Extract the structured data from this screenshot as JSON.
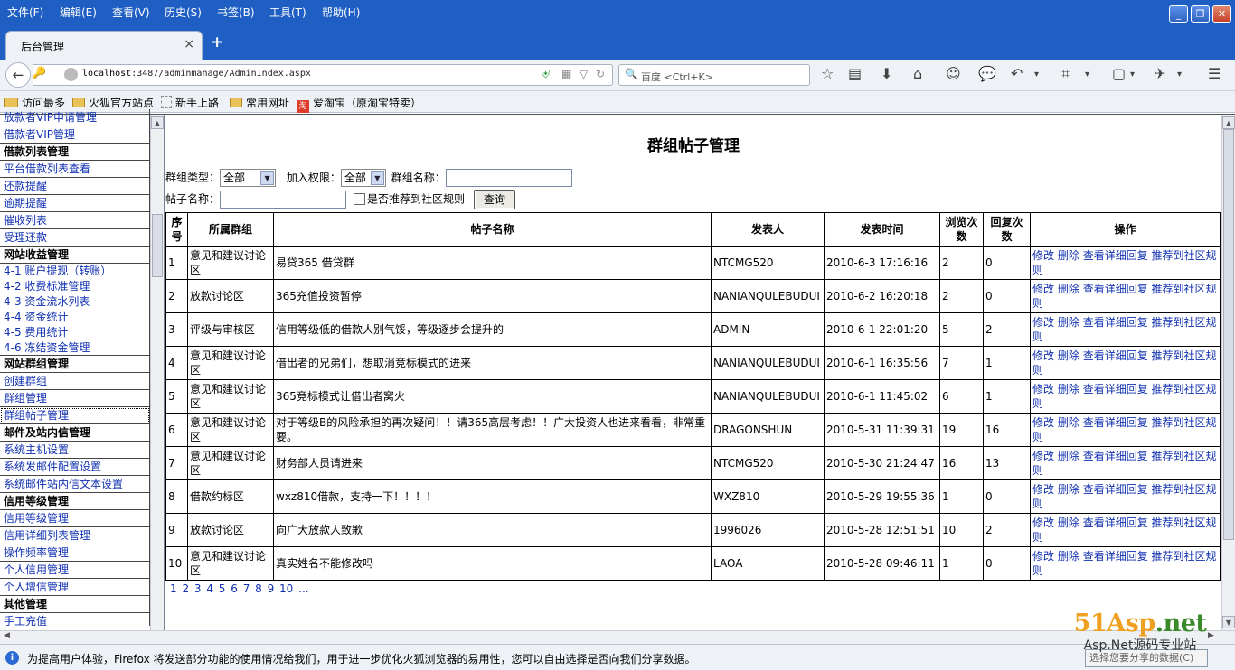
{
  "menu": [
    "文件(F)",
    "编辑(E)",
    "查看(V)",
    "历史(S)",
    "书签(B)",
    "工具(T)",
    "帮助(H)"
  ],
  "tab": {
    "title": "后台管理",
    "close": "×",
    "newtab": "+"
  },
  "url": {
    "host": "localhost",
    "rest": ":3487/adminmanage/AdminIndex.aspx"
  },
  "search": {
    "placeholder": "百度 <Ctrl+K>"
  },
  "bookmarks": [
    "访问最多",
    "火狐官方站点",
    "新手上路",
    "常用网址",
    "爱淘宝（原淘宝特卖）"
  ],
  "sidebar": [
    {
      "label": "放款者VIP申请管理",
      "type": "link"
    },
    {
      "label": "借款者VIP管理",
      "type": "link"
    },
    {
      "label": "借款列表管理",
      "type": "header"
    },
    {
      "label": "平台借款列表查看",
      "type": "link"
    },
    {
      "label": "还款提醒",
      "type": "link"
    },
    {
      "label": "逾期提醒",
      "type": "link"
    },
    {
      "label": "催收列表",
      "type": "link"
    },
    {
      "label": "受理还款",
      "type": "link"
    },
    {
      "label": "网站收益管理",
      "type": "header"
    },
    {
      "label": "4-1 账户提现（转账）",
      "type": "sub"
    },
    {
      "label": "4-2 收费标准管理",
      "type": "sub"
    },
    {
      "label": "4-3 资金流水列表",
      "type": "sub"
    },
    {
      "label": "4-4 资金统计",
      "type": "sub"
    },
    {
      "label": "4-5 费用统计",
      "type": "sub"
    },
    {
      "label": "4-6 冻结资金管理",
      "type": "sub-last"
    },
    {
      "label": "网站群组管理",
      "type": "header"
    },
    {
      "label": "创建群组",
      "type": "link"
    },
    {
      "label": "群组管理",
      "type": "link"
    },
    {
      "label": "群组帖子管理",
      "type": "active"
    },
    {
      "label": "邮件及站内信管理",
      "type": "header"
    },
    {
      "label": "系统主机设置",
      "type": "link"
    },
    {
      "label": "系统发邮件配置设置",
      "type": "link"
    },
    {
      "label": "系统邮件站内信文本设置",
      "type": "link"
    },
    {
      "label": "信用等级管理",
      "type": "header"
    },
    {
      "label": "信用等级管理",
      "type": "link"
    },
    {
      "label": "信用详细列表管理",
      "type": "link"
    },
    {
      "label": "操作频率管理",
      "type": "link"
    },
    {
      "label": "个人信用管理",
      "type": "link"
    },
    {
      "label": "个人增信管理",
      "type": "link"
    },
    {
      "label": "其他管理",
      "type": "header"
    },
    {
      "label": "手工充值",
      "type": "link"
    }
  ],
  "page": {
    "title": "群组帖子管理",
    "group_type_label": "群组类型：",
    "group_type_value": "全部",
    "join_perm_label": "加入权限：",
    "join_perm_value": "全部",
    "group_name_label": "群组名称：",
    "post_name_label": "帖子名称：",
    "recommend_label": "是否推荐到社区规则",
    "query_button": "查询"
  },
  "table": {
    "headers": [
      "序号",
      "所属群组",
      "帖子名称",
      "发表人",
      "发表时间",
      "浏览次数",
      "回复次数",
      "操作"
    ],
    "ops": [
      "修改",
      "删除",
      "查看详细回复",
      "推荐到社区规则"
    ],
    "rows": [
      [
        "1",
        "意见和建议讨论区",
        "易贷365 借贷群",
        "NTCMG520",
        "2010-6-3 17:16:16",
        "2",
        "0"
      ],
      [
        "2",
        "放款讨论区",
        "365充值投资暂停",
        "NANIANQULEBUDUI",
        "2010-6-2 16:20:18",
        "2",
        "0"
      ],
      [
        "3",
        "评级与审核区",
        "信用等级低的借款人别气馁，等级逐步会提升的",
        "ADMIN",
        "2010-6-1 22:01:20",
        "5",
        "2"
      ],
      [
        "4",
        "意见和建议讨论区",
        "借出者的兄弟们，想取消竞标模式的进来",
        "NANIANQULEBUDUI",
        "2010-6-1 16:35:56",
        "7",
        "1"
      ],
      [
        "5",
        "意见和建议讨论区",
        "365竞标模式让借出者窝火",
        "NANIANQULEBUDUI",
        "2010-6-1 11:45:02",
        "6",
        "1"
      ],
      [
        "6",
        "意见和建议讨论区",
        "对于等级B的风险承担的再次疑问！！请365高层考虑！！广大投资人也进来看看，非常重要。",
        "DRAGONSHUN",
        "2010-5-31 11:39:31",
        "19",
        "16"
      ],
      [
        "7",
        "意见和建议讨论区",
        "财务部人员请进来",
        "NTCMG520",
        "2010-5-30 21:24:47",
        "16",
        "13"
      ],
      [
        "8",
        "借款约标区",
        "wxz810借款，支持一下！！！！",
        "WXZ810",
        "2010-5-29 19:55:36",
        "1",
        "0"
      ],
      [
        "9",
        "放款讨论区",
        "向广大放款人致歉",
        "1996026",
        "2010-5-28 12:51:51",
        "10",
        "2"
      ],
      [
        "10",
        "意见和建议讨论区",
        "真实姓名不能修改吗",
        "LAOA",
        "2010-5-28 09:46:11",
        "1",
        "0"
      ]
    ]
  },
  "pager": "1 2 3 4 5 6 7 8 9 10 ...",
  "notification": {
    "text": "为提高用户体验，Firefox 将发送部分功能的使用情况给我们，用于进一步优化火狐浏览器的易用性，您可以自由选择是否向我们分享数据。",
    "button": "选择您要分享的数据(C)"
  },
  "watermark": {
    "brand_a": "51Asp",
    "brand_b": ".net",
    "tagline": "Asp.Net源码专业站"
  }
}
